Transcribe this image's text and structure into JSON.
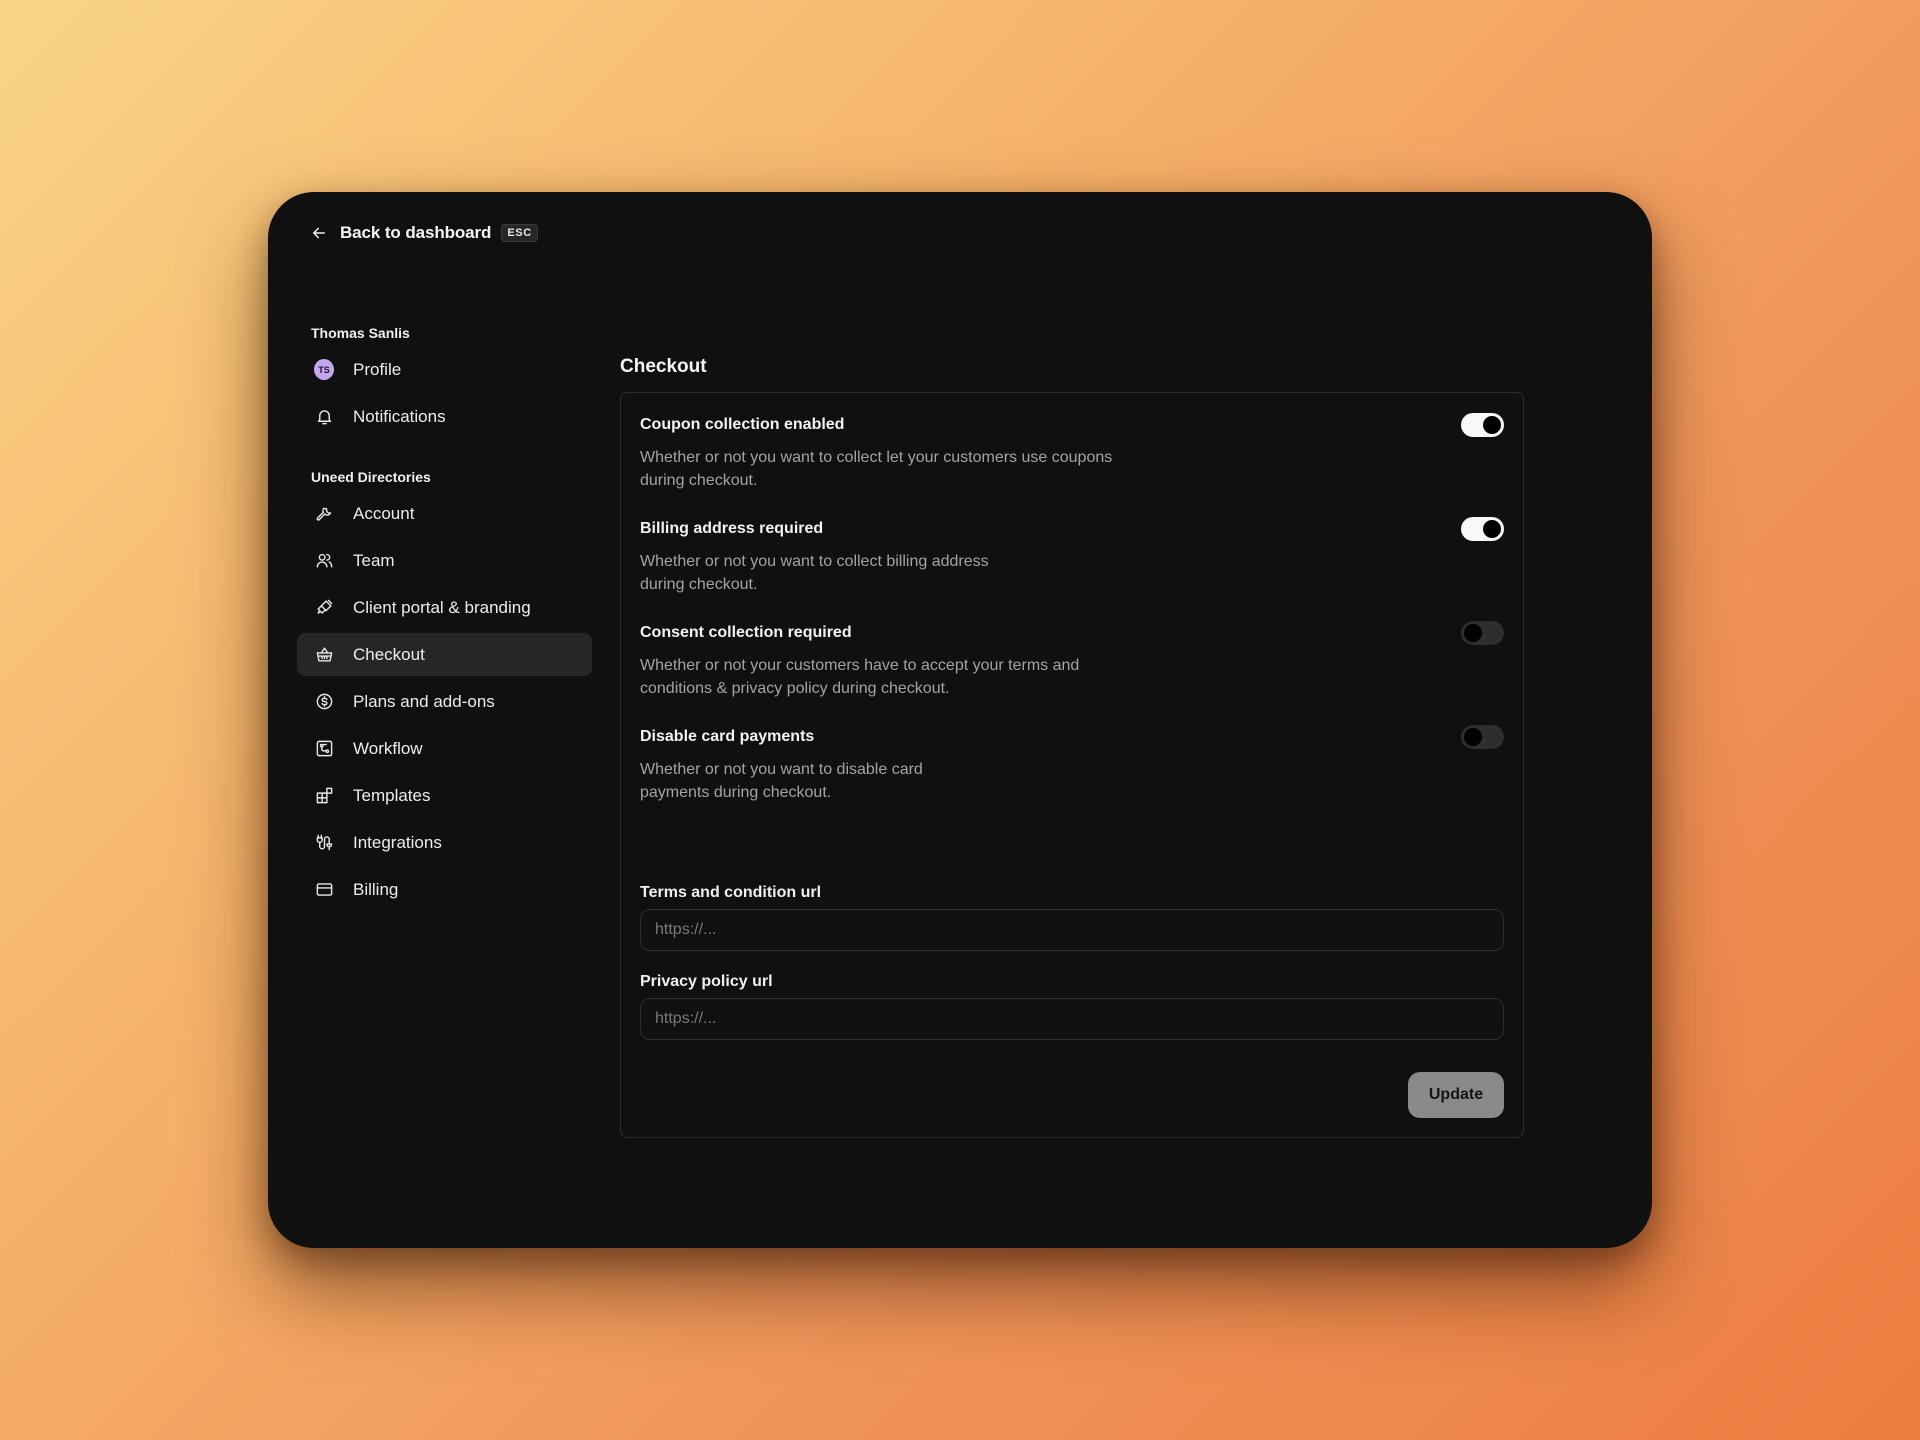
{
  "theme": {
    "window_bg": "#101010",
    "active_item_bg": "#262626",
    "avatar_bg": "#c6a7ee",
    "toggle_on": "#f8f8fa",
    "toggle_off": "#2e2e2e",
    "button_bg": "#8a8a8a",
    "background_gradient": [
      "#f9d485",
      "#ec7d40"
    ]
  },
  "header": {
    "back_icon": "arrow-left-icon",
    "back_label": "Back to dashboard",
    "shortcut": "ESC"
  },
  "sidebar": {
    "user_group": {
      "title": "Thomas Sanlis",
      "items": [
        {
          "label": "Profile",
          "icon": "avatar",
          "avatar_initials": "TS",
          "active": false
        },
        {
          "label": "Notifications",
          "icon": "bell-icon",
          "active": false
        }
      ]
    },
    "org_group": {
      "title": "Uneed Directories",
      "items": [
        {
          "label": "Account",
          "icon": "wrench-icon",
          "active": false
        },
        {
          "label": "Team",
          "icon": "users-icon",
          "active": false
        },
        {
          "label": "Client portal & branding",
          "icon": "brush-icon",
          "active": false
        },
        {
          "label": "Checkout",
          "icon": "basket-icon",
          "active": true
        },
        {
          "label": "Plans and add-ons",
          "icon": "dollar-badge-icon",
          "active": false
        },
        {
          "label": "Workflow",
          "icon": "workflow-icon",
          "active": false
        },
        {
          "label": "Templates",
          "icon": "templates-icon",
          "active": false
        },
        {
          "label": "Integrations",
          "icon": "plug-icon",
          "active": false
        },
        {
          "label": "Billing",
          "icon": "credit-card-icon",
          "active": false
        }
      ]
    }
  },
  "main": {
    "title": "Checkout",
    "settings": [
      {
        "title": "Coupon collection enabled",
        "description_lines": [
          "Whether or not you want to collect let your customers use coupons",
          "during checkout."
        ],
        "enabled": true
      },
      {
        "title": "Billing address required",
        "description_lines": [
          "Whether or not you want to collect billing address",
          "during checkout."
        ],
        "enabled": true
      },
      {
        "title": "Consent collection required",
        "description_lines": [
          "Whether or not your customers have to accept your terms and",
          "conditions & privacy policy during checkout."
        ],
        "enabled": false
      },
      {
        "title": "Disable card payments",
        "description_lines": [
          "Whether or not you want to disable card",
          "payments during checkout."
        ],
        "enabled": false
      }
    ],
    "fields": [
      {
        "label": "Terms and condition url",
        "value": "",
        "placeholder": "https://..."
      },
      {
        "label": "Privacy policy url",
        "value": "",
        "placeholder": "https://..."
      }
    ],
    "submit_label": "Update"
  }
}
